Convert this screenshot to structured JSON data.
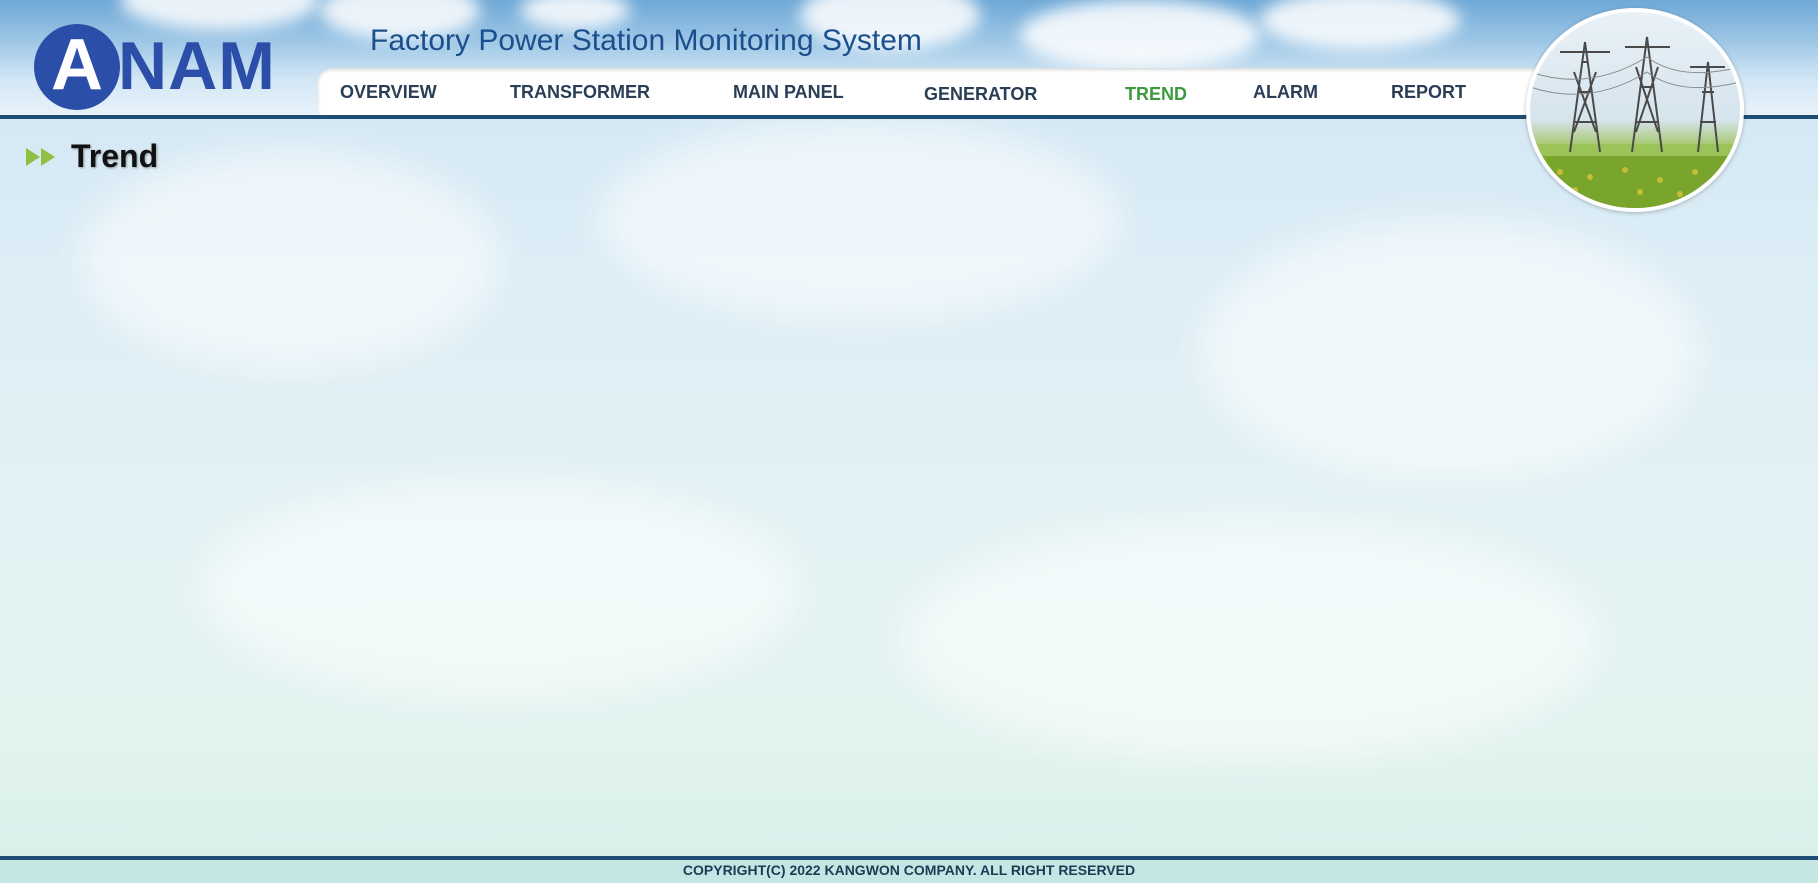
{
  "header": {
    "logo_text": "ANAM",
    "app_title": "Factory Power Station Monitoring System"
  },
  "nav": {
    "items": [
      {
        "label": "OVERVIEW",
        "active": false
      },
      {
        "label": "TRANSFORMER",
        "active": false
      },
      {
        "label": "MAIN PANEL",
        "active": false
      },
      {
        "label": "GENERATOR",
        "active": false
      },
      {
        "label": "TREND",
        "active": true
      },
      {
        "label": "ALARM",
        "active": false
      },
      {
        "label": "REPORT",
        "active": false
      }
    ]
  },
  "page": {
    "title": "Trend"
  },
  "footer": {
    "copyright": "COPYRIGHT(C) 2022 KANGWON COMPANY. ALL RIGHT RESERVED"
  },
  "colors": {
    "brand_blue": "#2b4ea8",
    "title_blue": "#1b4f8c",
    "active_nav": "#3f9a3f",
    "nav_text": "#2a3e55",
    "rule": "#1c4f73",
    "arrow_green": "#8fc043"
  },
  "icons": {
    "section": "double-chevron-right-icon",
    "badge": "power-tower-image"
  }
}
